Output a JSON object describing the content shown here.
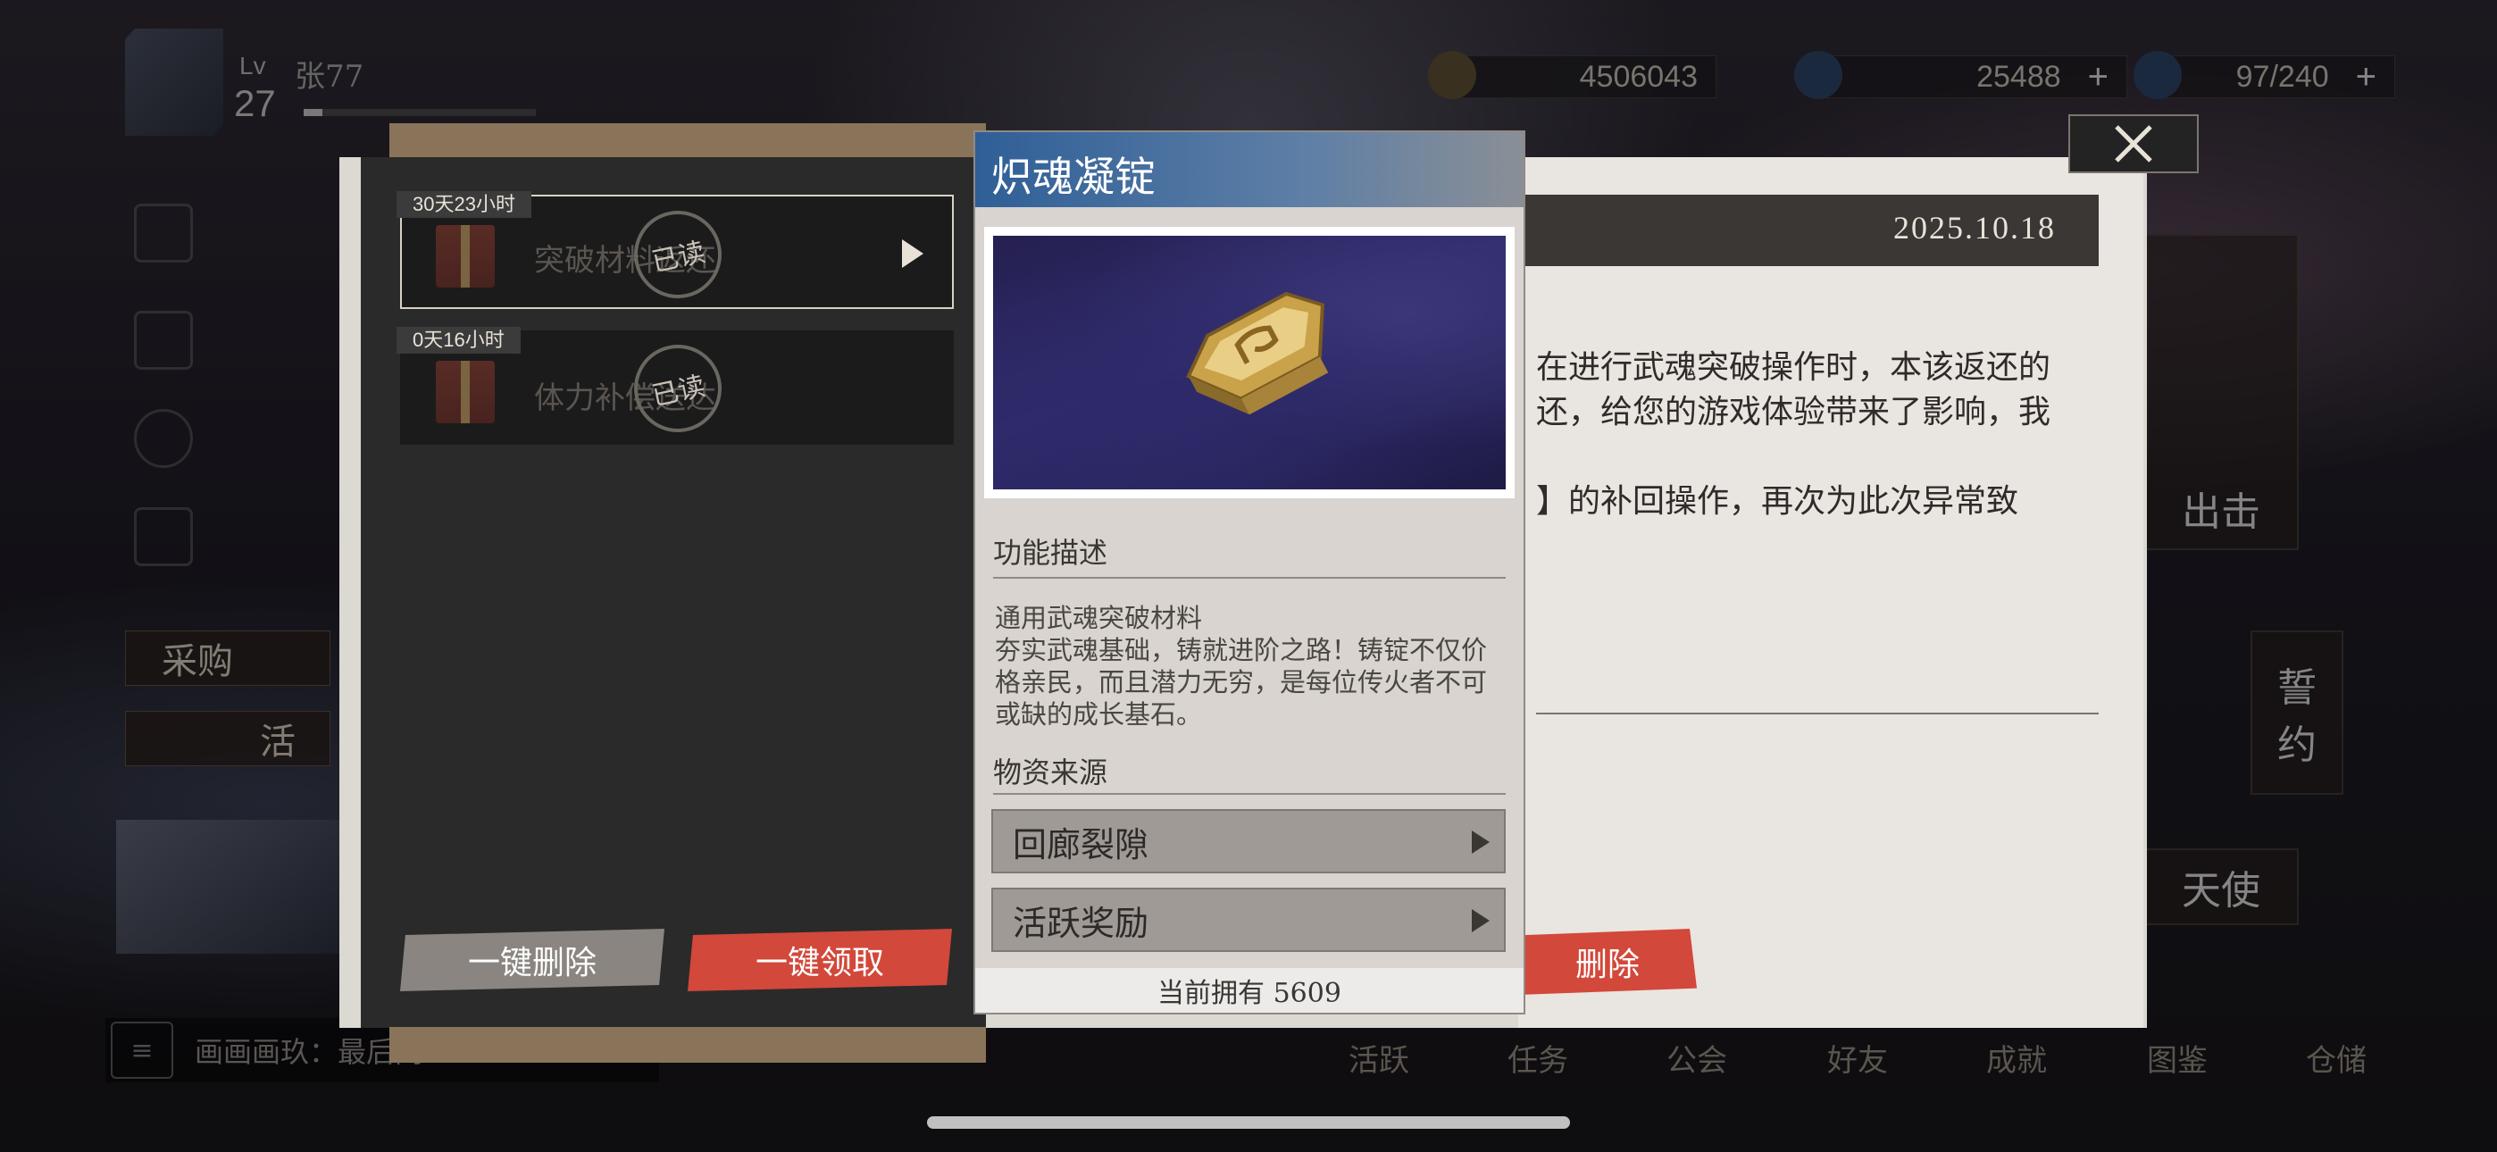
{
  "player": {
    "lv_label": "Lv",
    "level": "27",
    "name": "张77"
  },
  "resources": [
    {
      "icon": "coin-icon",
      "value": "4506043",
      "color": "#b8934a"
    },
    {
      "icon": "crystal-icon",
      "value": "25488",
      "color": "#5a8fc8"
    },
    {
      "icon": "stamina-icon",
      "value": "97/240",
      "color": "#6a9ad8"
    }
  ],
  "side": {
    "shop_label": "采购",
    "activity_label": "活"
  },
  "chat": {
    "text": "画画画玖：最后问…"
  },
  "nav": [
    "活跃",
    "任务",
    "公会",
    "好友",
    "成就",
    "图鉴",
    "仓储"
  ],
  "right_cards": {
    "sortie": "出击",
    "oath_1": "誓",
    "oath_2": "约",
    "angel": "天使"
  },
  "mail": {
    "items": [
      {
        "tag": "30天23小时",
        "title": "突破材料返还",
        "stamp": "已读"
      },
      {
        "tag": "0天16小时",
        "title": "体力补偿送达",
        "stamp": "已读"
      }
    ],
    "delete_all": "一键删除",
    "claim_all": "一键领取",
    "date": "2025.10.18",
    "body": [
      "在进行武魂突破操作时，本该返还的",
      "还，给您的游戏体验带来了影响，我",
      "】的补回操作，再次为此次异常致"
    ],
    "delete": "删除"
  },
  "item_tip": {
    "name": "炽魂凝锭",
    "section_desc": "功能描述",
    "desc_1": "通用武魂突破材料",
    "desc_2": "夯实武魂基础，铸就进阶之路！铸锭不仅价格亲民，而且潜力无穷，是每位传火者不可或缺的成长基石。",
    "section_source": "物资来源",
    "sources": [
      "回廊裂隙",
      "活跃奖励"
    ],
    "owned": "当前拥有 5609"
  }
}
